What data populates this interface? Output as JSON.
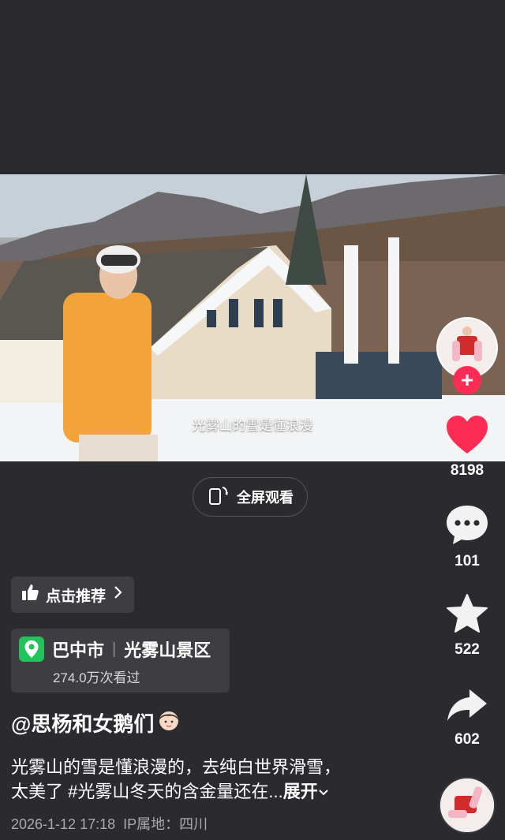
{
  "video": {
    "subtitle": "光雾山的雪是懂浪漫"
  },
  "fullscreen": {
    "label": "全屏观看",
    "icon": "phone-rotate-icon"
  },
  "recommend": {
    "label": "点击推荐",
    "icon": "thumbs-up-icon"
  },
  "location": {
    "city": "巴中市",
    "place": "光雾山景区",
    "separator": "|",
    "views": "274.0万次看过",
    "icon": "location-pin-icon",
    "pin_color": "#23c25a"
  },
  "author": {
    "handle": "@思杨和女鹅们"
  },
  "description": {
    "line1": "光雾山的雪是懂浪漫的，去纯白世界滑雪，",
    "line2": "太美了 #光雾山冬天的含金量还在...",
    "expand": "展开"
  },
  "meta": {
    "datetime": "2026-1-12 17:18",
    "ip": "IP属地：四川"
  },
  "sidebar": {
    "likes": "8198",
    "comments": "101",
    "favorites": "522",
    "shares": "602",
    "like_color": "#fe2c55",
    "follow_color": "#fe2c55"
  }
}
